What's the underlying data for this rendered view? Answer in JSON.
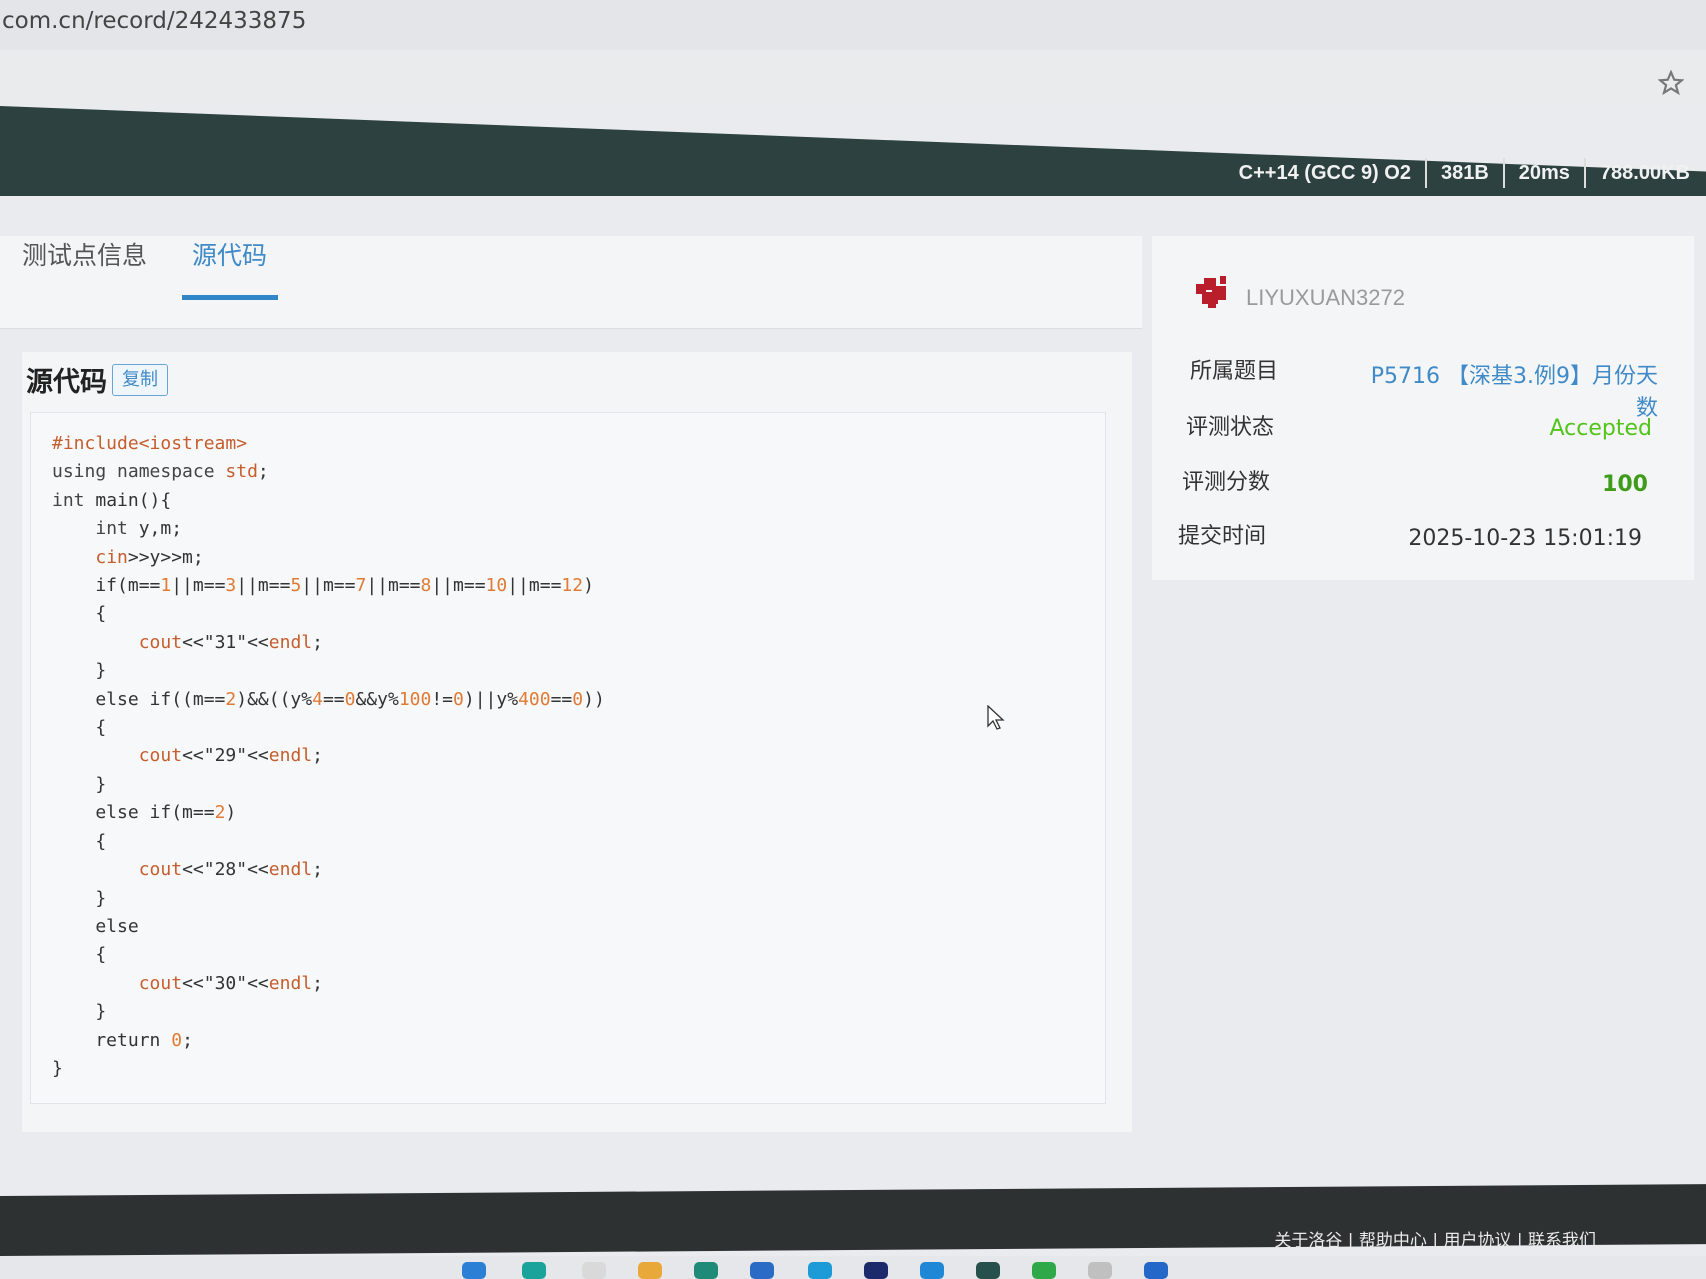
{
  "browser": {
    "url": "com.cn/record/242433875"
  },
  "record_bar": {
    "language": "C++14 (GCC 9) O2",
    "code_size": "381B",
    "time": "20ms",
    "memory": "788.00KB"
  },
  "tabs": [
    {
      "label": "测试点信息"
    },
    {
      "label": "源代码"
    }
  ],
  "source": {
    "title": "源代码",
    "copy_label": "复制"
  },
  "sidebar": {
    "username": "LIYUXUAN3272",
    "problem_label": "所属题目",
    "problem_value": "P5716 【深基3.例9】月份天数",
    "status_label": "评测状态",
    "status_value": "Accepted",
    "score_label": "评测分数",
    "score_value": "100",
    "time_label": "提交时间",
    "time_value": "2025-10-23 15:01:19"
  },
  "footer": {
    "links": "关于洛谷 | 帮助中心 | 用户协议 | 联系我们"
  },
  "colors": {
    "accepted": "#52c41a",
    "link": "#3f8ac7",
    "topbar": "#2d4140"
  }
}
